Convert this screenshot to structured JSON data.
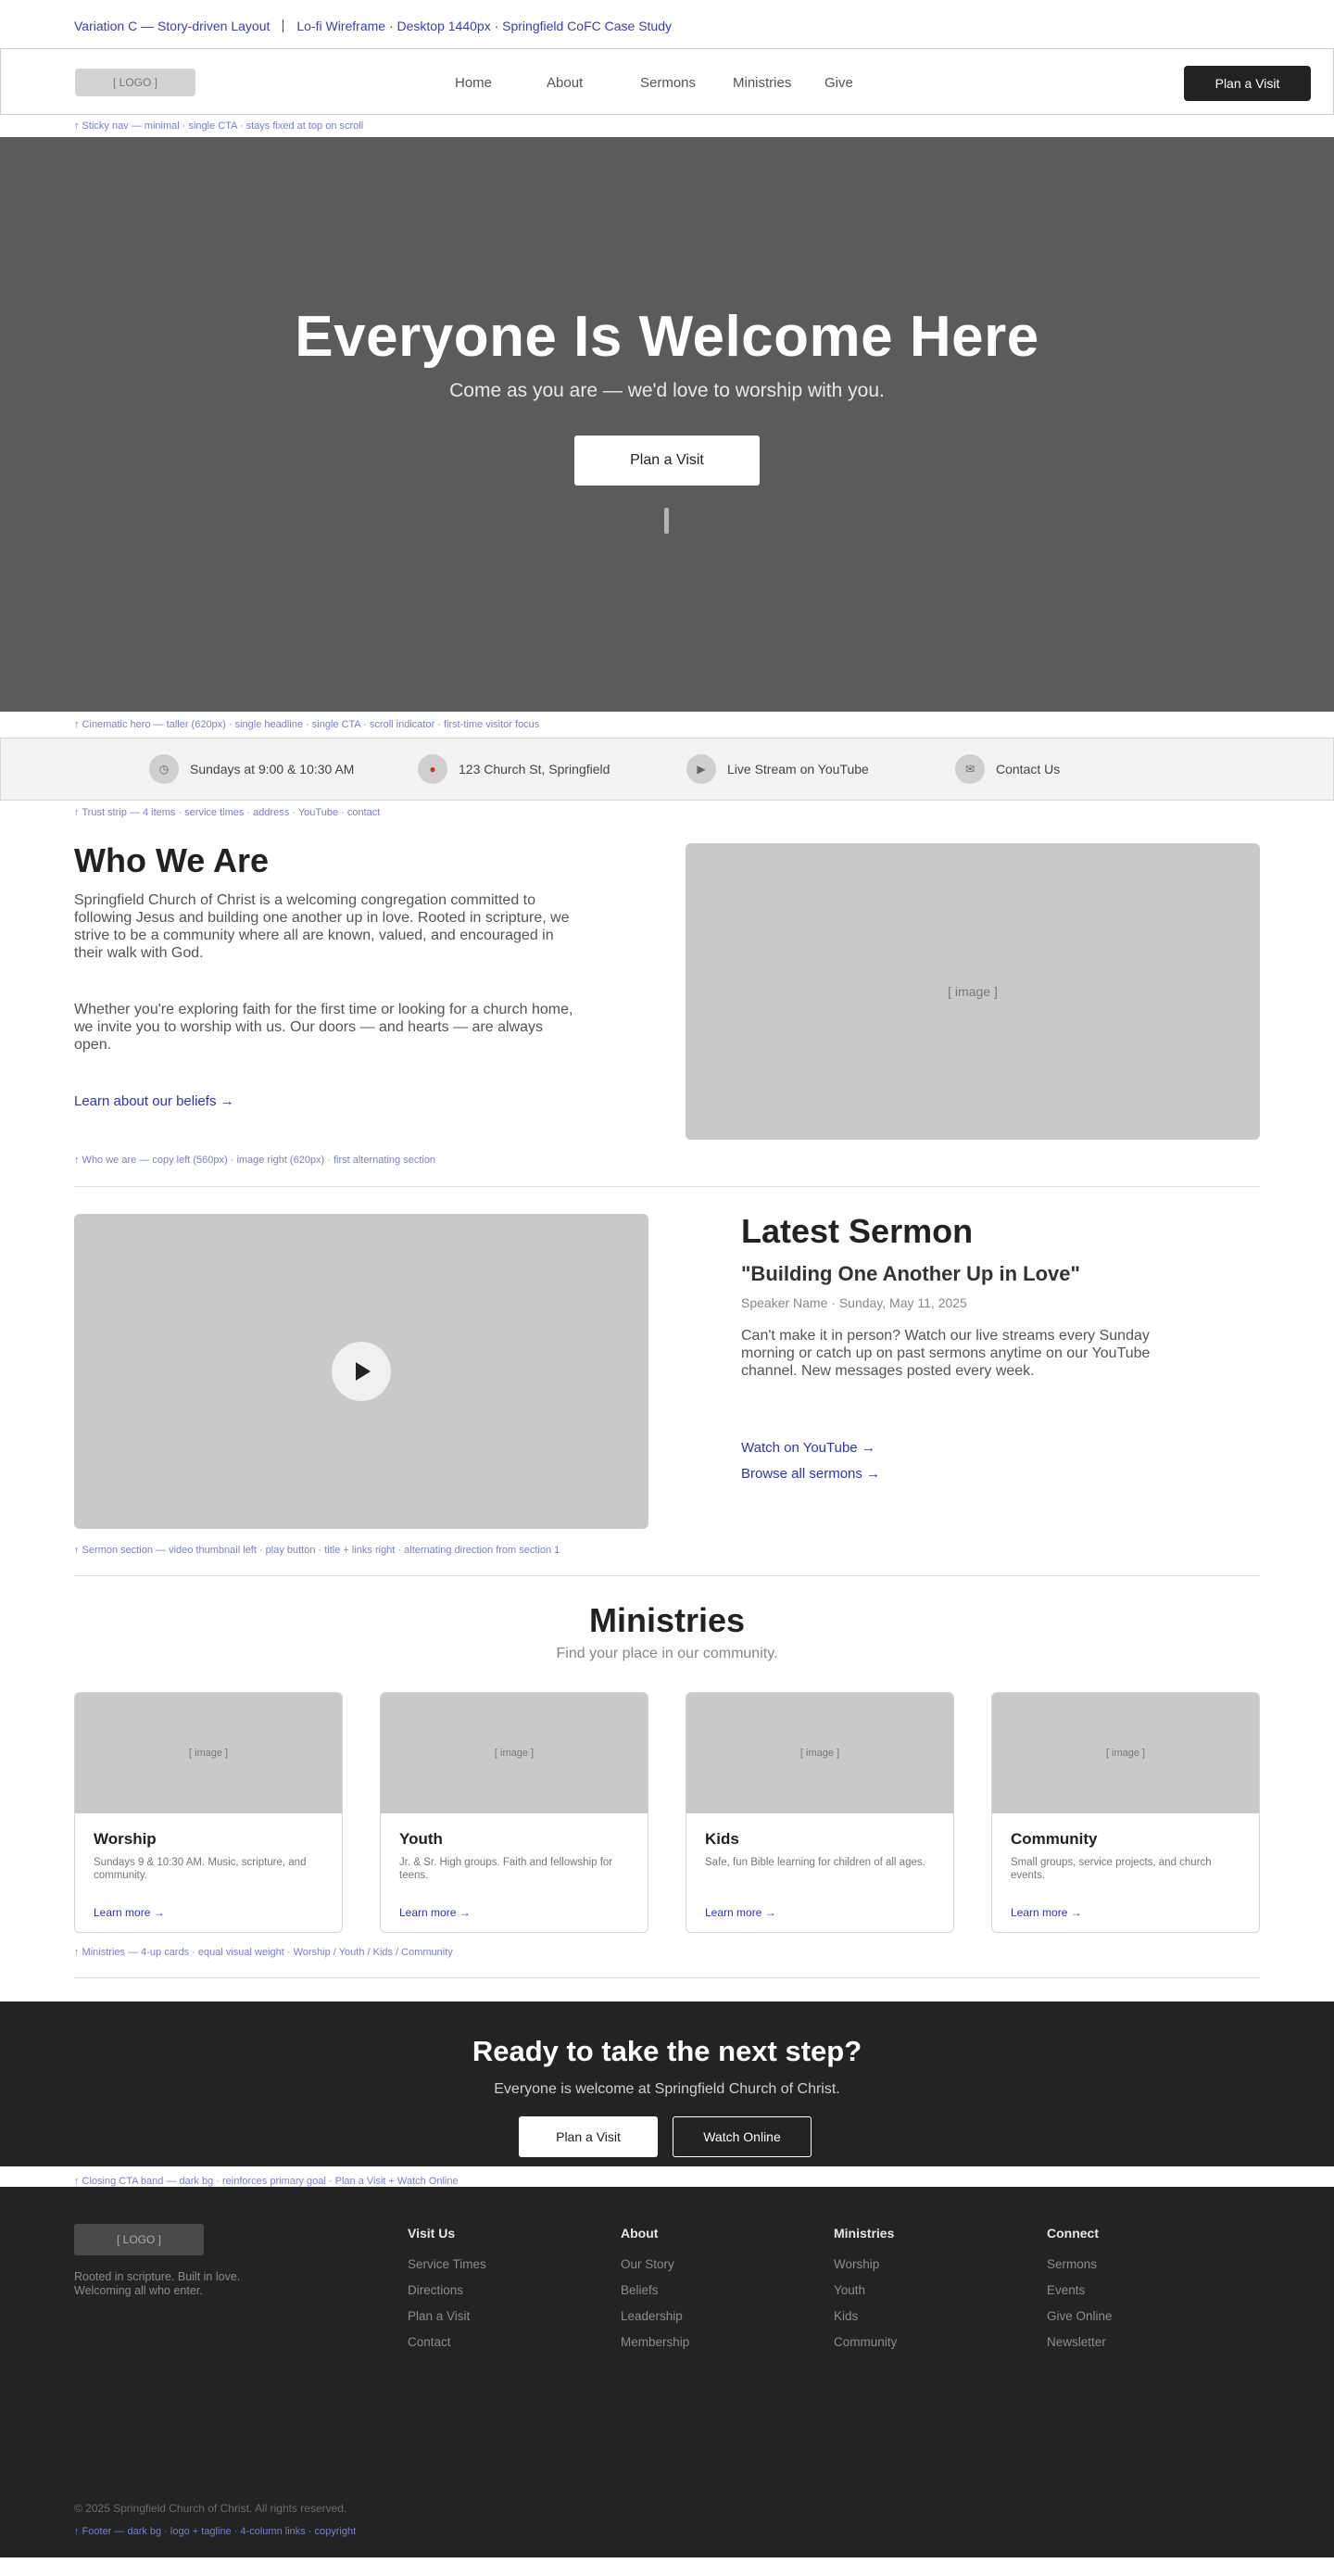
{
  "top_label": {
    "variation": "Variation C — Story-driven Layout",
    "detail": "Lo-fi Wireframe · Desktop 1440px · Springfield CoFC Case Study"
  },
  "nav": {
    "logo": "[ LOGO ]",
    "links": [
      "Home",
      "About",
      "Sermons",
      "Ministries",
      "Give"
    ],
    "cta": "Plan a Visit",
    "note": "↑ Sticky nav — minimal · single CTA · stays fixed at top on scroll"
  },
  "hero": {
    "title": "Everyone Is Welcome Here",
    "subtitle": "Come as you are — we'd love to worship with you.",
    "cta": "Plan a Visit",
    "note": "↑ Cinematic hero — taller (620px) · single headline · single CTA · scroll indicator · first-time visitor focus"
  },
  "trust": {
    "items": [
      {
        "icon": "clock-icon",
        "text": "Sundays at 9:00 & 10:30 AM"
      },
      {
        "icon": "map-pin-icon",
        "text": "123 Church St, Springfield"
      },
      {
        "icon": "play-icon",
        "text": "Live Stream on YouTube"
      },
      {
        "icon": "mail-icon",
        "text": "Contact Us"
      }
    ],
    "note": "↑ Trust strip — 4 items · service times · address · YouTube · contact"
  },
  "who": {
    "title": "Who We Are",
    "p1": "Springfield Church of Christ is a welcoming congregation committed to following Jesus and building one another up in love. Rooted in scripture, we strive to be a community where all are known, valued, and encouraged in their walk with God.",
    "p2": "Whether you're exploring faith for the first time or looking for a church home, we invite you to worship with us. Our doors — and hearts — are always open.",
    "link": "Learn about our beliefs →",
    "image": "[ image ]",
    "note": "↑ Who we are — copy left (560px) · image right (620px) · first alternating section"
  },
  "sermon": {
    "title": "Latest Sermon",
    "name": "\"Building One Another Up in Love\"",
    "meta": "Speaker Name · Sunday, May 11, 2025",
    "desc": "Can't make it in person? Watch our live streams every Sunday morning or catch up on past sermons anytime on our YouTube channel. New messages posted every week.",
    "link1": "Watch on YouTube →",
    "link2": "Browse all sermons →",
    "note": "↑ Sermon section — video thumbnail left · play button · title + links right · alternating direction from section 1"
  },
  "ministries": {
    "title": "Ministries",
    "subtitle": "Find your place in our community.",
    "cards": [
      {
        "image": "[ image ]",
        "title": "Worship",
        "desc": "Sundays 9 & 10:30 AM. Music, scripture, and community.",
        "link": "Learn more →"
      },
      {
        "image": "[ image ]",
        "title": "Youth",
        "desc": "Jr. & Sr. High groups. Faith and fellowship for teens.",
        "link": "Learn more →"
      },
      {
        "image": "[ image ]",
        "title": "Kids",
        "desc": "Safe, fun Bible learning for children of all ages.",
        "link": "Learn more →"
      },
      {
        "image": "[ image ]",
        "title": "Community",
        "desc": "Small groups, service projects, and church events.",
        "link": "Learn more →"
      }
    ],
    "note": "↑ Ministries — 4-up cards · equal visual weight · Worship / Youth / Kids / Community"
  },
  "closing": {
    "title": "Ready to take the next step?",
    "subtitle": "Everyone is welcome at Springfield Church of Christ.",
    "primary": "Plan a Visit",
    "secondary": "Watch Online",
    "note": "↑ Closing CTA band — dark bg · reinforces primary goal · Plan a Visit + Watch Online"
  },
  "footer": {
    "logo": "[ LOGO ]",
    "tagline": "Rooted in scripture. Built in love. Welcoming all who enter.",
    "columns": [
      {
        "heading": "Visit Us",
        "links": [
          "Service Times",
          "Directions",
          "Plan a Visit",
          "Contact"
        ]
      },
      {
        "heading": "About",
        "links": [
          "Our Story",
          "Beliefs",
          "Leadership",
          "Membership"
        ]
      },
      {
        "heading": "Ministries",
        "links": [
          "Worship",
          "Youth",
          "Kids",
          "Community"
        ]
      },
      {
        "heading": "Connect",
        "links": [
          "Sermons",
          "Events",
          "Give Online",
          "Newsletter"
        ]
      }
    ],
    "copyright": "© 2025 Springfield Church of Christ. All rights reserved.",
    "note": "↑ Footer — dark bg · logo + tagline · 4-column links · copyright"
  },
  "colors": {
    "annotation": "#7a7fc9",
    "link": "#2f33b8",
    "dark": "#232323",
    "hero_bg": "#5b5b5b",
    "placeholder": "#c9c9c9"
  }
}
